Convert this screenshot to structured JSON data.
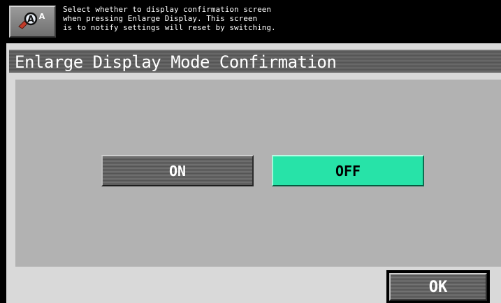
{
  "header": {
    "accessibility_icon": "accessibility-enlarge-icon",
    "message_lines": [
      "Select whether to display confirmation screen",
      "when pressing Enlarge Display. This screen",
      "is to notify settings will reset by switching."
    ]
  },
  "page": {
    "title": "Enlarge Display Mode Confirmation"
  },
  "options": {
    "on_label": "ON",
    "off_label": "OFF",
    "selected": "OFF"
  },
  "footer": {
    "ok_label": "OK"
  },
  "colors": {
    "selected_accent": "#27e3a8",
    "button_gray": "#6a6a6a",
    "panel_bg": "#d9d9d9",
    "content_bg": "#b2b2b2"
  }
}
